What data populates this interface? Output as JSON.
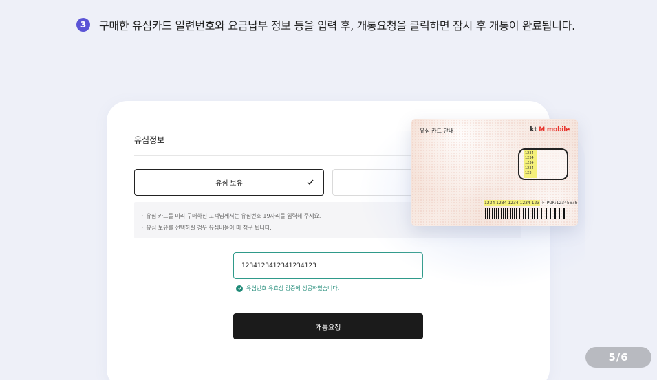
{
  "instruction": {
    "step_number": "3",
    "text": "구매한 유심카드 일련번호와 요금납부 정보 등을 입력 후, 개통요청을 클릭하면 잠시 후 개통이 완료됩니다."
  },
  "form": {
    "section_title": "유심정보",
    "option_have_label": "유심 보유",
    "option_have_selected": true,
    "notices": [
      "유심 카드를 미리 구매하신 고객님께서는 유심번호 19자리를 입력해 주세요.",
      "유심 보유를 선택하실 경우 유심비용이 미 청구 됩니다."
    ],
    "serial_value": "1234123412341234123",
    "validation_message": "유심번호 유효성 검증에 성공하였습니다.",
    "submit_label": "개통요청"
  },
  "sim_card": {
    "title": "유심 카드 안내",
    "brand_kt": "kt",
    "brand_mobile": "M mobile",
    "chip_numbers": [
      "1234",
      "1234",
      "1234",
      "1234",
      "123"
    ],
    "serial_strip": "1234 1234 1234 1234 123",
    "serial_suffix": "F",
    "puk": "PUK:12345678"
  },
  "pager": {
    "text": "5/6"
  },
  "colors": {
    "accent_step": "#5b54d6",
    "valid_green": "#1f8a77",
    "brand_red": "#e8322b",
    "submit_bg": "#1b1b1b"
  },
  "icons": [
    "check-icon",
    "check-circle-icon",
    "barcode"
  ]
}
